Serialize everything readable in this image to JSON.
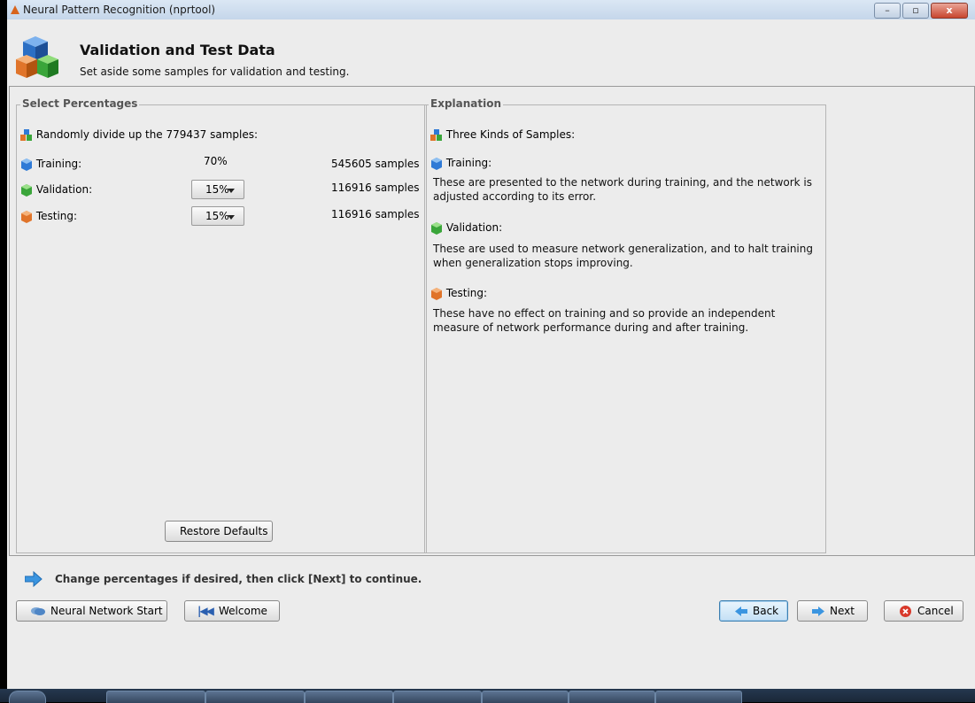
{
  "window": {
    "title": "Neural Pattern Recognition (nprtool)"
  },
  "header": {
    "title": "Validation and Test Data",
    "subtitle": "Set aside some samples for validation and testing."
  },
  "select_panel": {
    "legend": "Select Percentages",
    "intro": "Randomly divide up the 779437 samples:",
    "rows": [
      {
        "label": "Training:",
        "percent": "70%",
        "samples": "545605 samples",
        "color": "#2f7ad6"
      },
      {
        "label": "Validation:",
        "percent": "15%",
        "samples": "116916 samples",
        "color": "#3aa53a"
      },
      {
        "label": "Testing:",
        "percent": "15%",
        "samples": "116916 samples",
        "color": "#e0742a"
      }
    ],
    "restore_label": "Restore Defaults"
  },
  "explanation": {
    "legend": "Explanation",
    "heading": "Three Kinds of Samples:",
    "sections": [
      {
        "title": "Training:",
        "text": "These are presented to the network during training, and the network is adjusted according to its error."
      },
      {
        "title": "Validation:",
        "text": "These are used to measure network generalization, and to halt training when generalization stops improving."
      },
      {
        "title": "Testing:",
        "text": "These have no effect on training and so provide an independent measure of network performance during and after training."
      }
    ]
  },
  "status": {
    "message": "Change percentages if desired, then click [Next] to continue."
  },
  "buttons": {
    "neural_start": "Neural Network Start",
    "welcome": "Welcome",
    "back": "Back",
    "next": "Next",
    "cancel": "Cancel"
  },
  "window_controls": {
    "minimize": "–",
    "maximize": "▫",
    "close": "x"
  }
}
